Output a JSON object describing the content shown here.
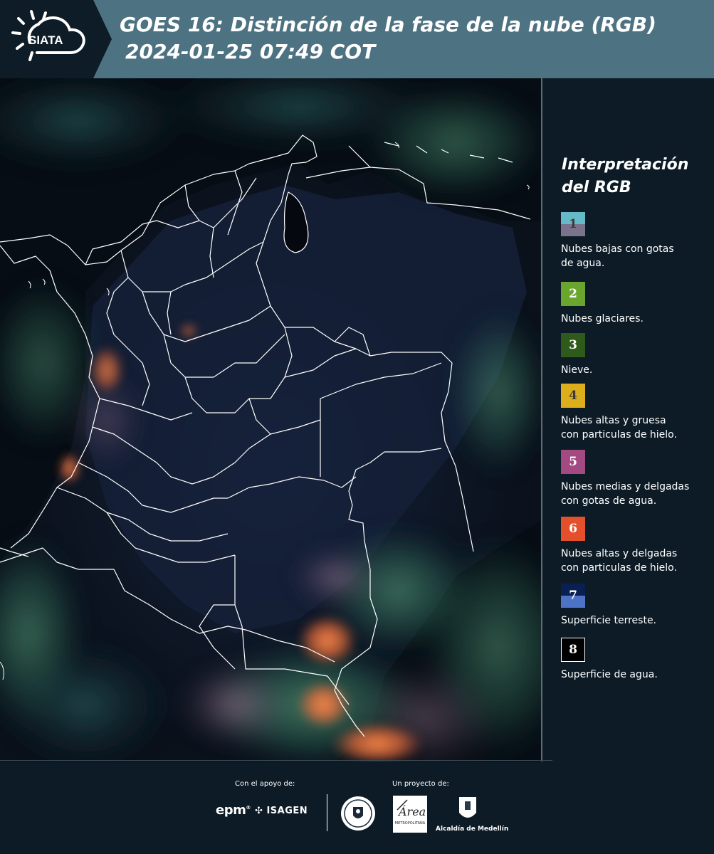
{
  "header": {
    "logo_text": "SIATA",
    "title": "GOES 16: Distinción de la fase de la nube (RGB)",
    "subtitle": "2024-01-25 07:49 COT"
  },
  "legend": {
    "title_line1": "Interpretación",
    "title_line2": "del RGB",
    "items": [
      {
        "number": "1",
        "label_line1": "Nubes bajas con gotas",
        "label_line2": "de agua.",
        "color_top": "#66b9c6",
        "color_bottom": "#7b728b"
      },
      {
        "number": "2",
        "label_line1": "Nubes glaciares.",
        "label_line2": "",
        "color_top": "#6aa62e",
        "color_bottom": "#6aa62e"
      },
      {
        "number": "3",
        "label_line1": "Nieve.",
        "label_line2": "",
        "color_top": "#2e5a1c",
        "color_bottom": "#2e5a1c"
      },
      {
        "number": "4",
        "label_line1": "Nubes altas y gruesa",
        "label_line2": "con particulas de hielo.",
        "color_top": "#dcae1c",
        "color_bottom": "#dcae1c"
      },
      {
        "number": "5",
        "label_line1": "Nubes medias y delgadas",
        "label_line2": "con gotas de agua.",
        "color_top": "#a34a83",
        "color_bottom": "#a34a83"
      },
      {
        "number": "6",
        "label_line1": "Nubes altas y delgadas",
        "label_line2": "con particulas de hielo.",
        "color_top": "#e5502c",
        "color_bottom": "#e5502c"
      },
      {
        "number": "7",
        "label_line1": "Superficie terreste.",
        "label_line2": "",
        "color_top": "#0a1f52",
        "color_bottom": "#4d73c6"
      },
      {
        "number": "8",
        "label_line1": "Superficie de agua.",
        "label_line2": "",
        "color_top": "#000000",
        "color_bottom": "#000000"
      }
    ]
  },
  "footer": {
    "support_label": "Con el apoyo de:",
    "project_label": "Un proyecto de:",
    "epm": "epm",
    "isagen": "ISAGEN",
    "area_name": "Área",
    "area_sub": "METROPOLITANA",
    "medellin": "Alcaldía de Medellín"
  },
  "colors": {
    "header_bg": "#4d7281",
    "panel_bg": "#0c1b26",
    "cloud_orange": "#f0743a",
    "cloud_green": "#3c8a6a"
  }
}
